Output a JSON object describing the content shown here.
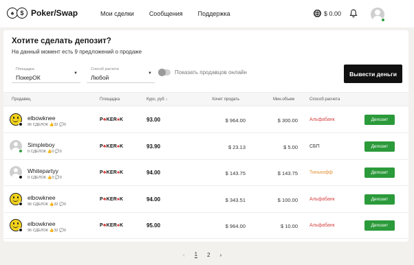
{
  "header": {
    "logo_symbols": [
      "♠",
      "$"
    ],
    "logo_text": "Poker/Swap",
    "nav": [
      "Мои сделки",
      "Сообщения",
      "Поддержка"
    ],
    "balance": "$ 0.00"
  },
  "main": {
    "title": "Хотите сделать депозит?",
    "subtitle": "На данный момент есть 9 предложений о продаже",
    "filters": {
      "site": {
        "label": "Площадка",
        "value": "ПокерОК"
      },
      "payment": {
        "label": "Способ расчета",
        "value": "Любой"
      },
      "online_toggle": "Показать продавцов онлайн"
    },
    "withdraw_label": "Вывести деньги"
  },
  "table": {
    "headers": [
      "Продавец",
      "Площадка",
      "Курс, руб",
      "Хочет продать",
      "Мин.объем",
      "Способ расчета"
    ],
    "sort_arrow": "↓",
    "deposit_label": "Депозит",
    "rows": [
      {
        "avatar": "smiley",
        "status": "offline",
        "name": "elbowknee",
        "deals": "96 СДЕЛОК",
        "likes": "32",
        "dislikes": "0",
        "site": [
          "P",
          "♣",
          "KER",
          "♠",
          "K"
        ],
        "rate": "93.00",
        "amount": "$ 964.00",
        "min": "$ 300.00",
        "method": "Альфабанк",
        "method_color": "#d64545"
      },
      {
        "avatar": "default",
        "status": "online",
        "name": "Simpleboy",
        "deals": "0 СДЕЛОК",
        "likes": "0",
        "dislikes": "0",
        "site": [
          "P",
          "♣",
          "KER",
          "♠",
          "K"
        ],
        "rate": "93.90",
        "amount": "$ 23.13",
        "min": "$ 5.00",
        "method": "СБП",
        "method_color": "#333333"
      },
      {
        "avatar": "default",
        "status": "offline",
        "name": "Whitepartyy",
        "deals": "0 СДЕЛОК",
        "likes": "0",
        "dislikes": "0",
        "site": [
          "P",
          "♣",
          "KER",
          "♠",
          "K"
        ],
        "rate": "94.00",
        "amount": "$ 143.75",
        "min": "$ 143.75",
        "method": "Тинькофф",
        "method_color": "#e0943a"
      },
      {
        "avatar": "smiley",
        "status": "offline",
        "name": "elbowknee",
        "deals": "96 СДЕЛОК",
        "likes": "32",
        "dislikes": "0",
        "site": [
          "P",
          "♣",
          "KER",
          "♠",
          "K"
        ],
        "rate": "94.00",
        "amount": "$ 343.51",
        "min": "$ 100.00",
        "method": "Альфабанк",
        "method_color": "#d64545"
      },
      {
        "avatar": "smiley",
        "status": "offline",
        "name": "elbowknee",
        "deals": "96 СДЕЛОК",
        "likes": "32",
        "dislikes": "0",
        "site": [
          "P",
          "♣",
          "KER",
          "♠",
          "K"
        ],
        "rate": "95.00",
        "amount": "$ 964.00",
        "min": "$ 10.00",
        "method": "Альфабанк",
        "method_color": "#d64545"
      }
    ]
  },
  "pagination": {
    "prev": "‹",
    "pages": [
      "1",
      "2"
    ],
    "current": "1",
    "next": "›"
  },
  "colors": {
    "accent_green": "#2b9a3a",
    "online": "#2e9c3b",
    "dark": "#111111",
    "background": "#f3f1ee"
  }
}
